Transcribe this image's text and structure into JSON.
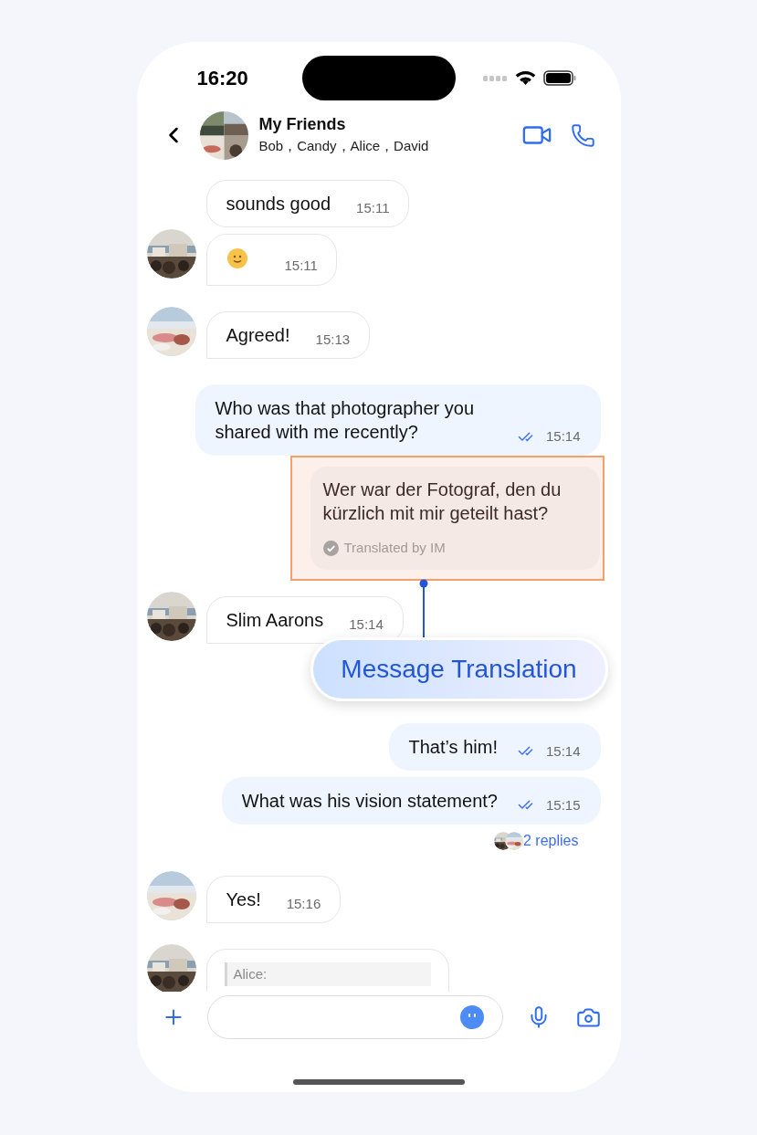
{
  "status_bar": {
    "time": "16:20"
  },
  "header": {
    "title": "My Friends",
    "members": "Bob，Candy，Alice，David"
  },
  "messages": [
    {
      "kind": "text",
      "outgoing": false,
      "avatar": false,
      "text": "sounds good",
      "time": "15:11"
    },
    {
      "kind": "emoji",
      "outgoing": false,
      "avatar": true,
      "time": "15:11"
    },
    {
      "kind": "text",
      "outgoing": false,
      "avatar": true,
      "text": "Agreed!",
      "time": "15:13"
    },
    {
      "kind": "text",
      "outgoing": true,
      "read": true,
      "text": "Who was that photographer you shared with me recently?",
      "time": "15:14"
    },
    {
      "kind": "translation",
      "outgoing": true,
      "highlighted": true,
      "text": "Wer war der Fotograf, den du kürzlich mit mir geteilt hast?",
      "note": "Translated by IM"
    },
    {
      "kind": "text",
      "outgoing": false,
      "avatar": true,
      "text": "Slim Aarons",
      "time": "15:14"
    },
    {
      "kind": "text",
      "outgoing": true,
      "read": true,
      "text": "That’s him!",
      "time": "15:14"
    },
    {
      "kind": "text",
      "outgoing": true,
      "read": true,
      "text": "What was his vision statement?",
      "time": "15:15",
      "replies": "2 replies"
    },
    {
      "kind": "text",
      "outgoing": false,
      "avatar": true,
      "text": "Yes!",
      "time": "15:16"
    },
    {
      "kind": "quote",
      "outgoing": false,
      "avatar": true,
      "quote": "Alice:"
    }
  ],
  "callout": {
    "label": "Message Translation"
  }
}
